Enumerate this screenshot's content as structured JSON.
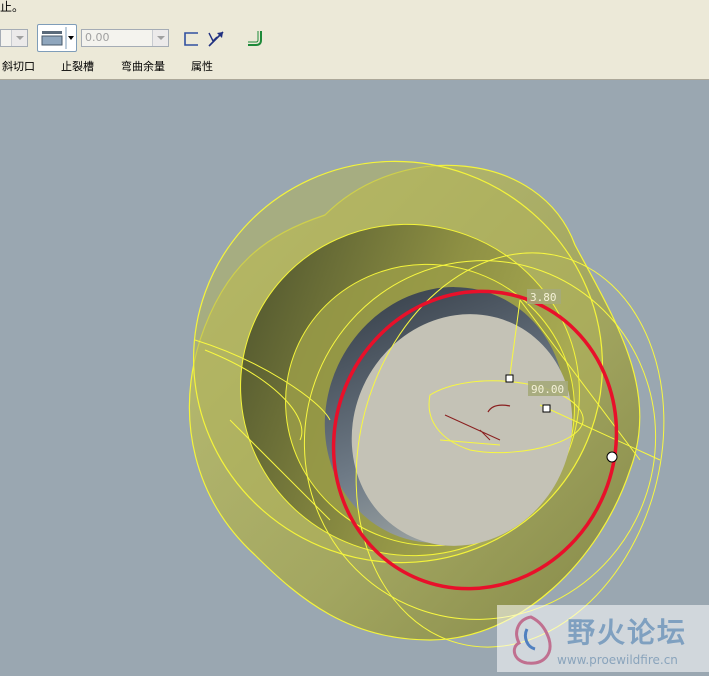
{
  "app": {
    "prompt_message": "止。"
  },
  "toolbar": {
    "thickness_value": "0.00",
    "labels": {
      "bevel_cut": "斜切口",
      "relief_groove": "止裂槽",
      "bend_allowance": "弯曲余量",
      "properties": "属性"
    },
    "icons": [
      "dropdown-icon",
      "edge-type-icon",
      "thickness-dropdown",
      "square-edge-icon",
      "flip-direction-icon",
      "bend-icon"
    ]
  },
  "viewport": {
    "dimension_1": "3.80",
    "dimension_2": "90.00",
    "background": "#9aa7b1",
    "model_color": "#b6b85a",
    "edge_color": "#ffff40",
    "highlight_color": "#e8102a"
  },
  "watermark": {
    "title": "野火论坛",
    "url": "www.proewildfire.cn"
  }
}
